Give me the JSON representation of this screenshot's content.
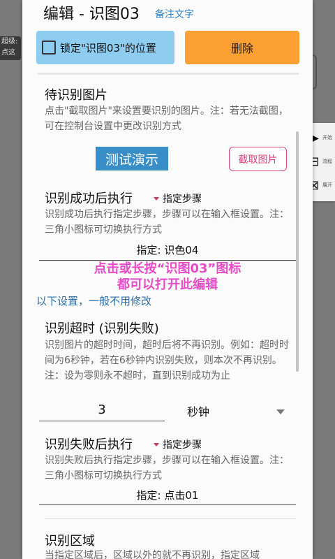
{
  "background": {
    "chip_line1": "超级:",
    "chip_line2": "点这可"
  },
  "float_toolbar": {
    "items": [
      {
        "icon": "play-icon",
        "glyph": "▶",
        "label": "开始"
      },
      {
        "icon": "flow-icon",
        "glyph": "⊟",
        "label": "流程"
      },
      {
        "icon": "collapse-icon",
        "glyph": "⊠",
        "label": "展开"
      }
    ]
  },
  "dialog": {
    "title": "编辑 - 识图03",
    "memo_link": "备注文字",
    "lock_label": "锁定\"识图03\"的位置",
    "delete_label": "删除",
    "image_section": {
      "title": "待识别图片",
      "desc": "点击\"截取图片\"来设置要识别的图片。注：若无法截图，可在控制台设置中更改识别方式",
      "demo_label": "测试演示",
      "capture_label": "截取图片"
    },
    "success_section": {
      "title": "识别成功后执行",
      "mode_label": "指定步骤",
      "desc": "识别成功后执行指定步骤，步骤可以在输入框设置。注：三角小图标可切换执行方式",
      "value": "指定: 识色04"
    },
    "overlay_hint": {
      "line1": "点击或长按“识图03”图标",
      "line2": "都可以打开此编辑"
    },
    "optional_note": "以下设置，一般不用修改",
    "timeout_section": {
      "title": "识别超时 (识别失败)",
      "desc": "识别图片的超时时间，超时后将不再识别。例如：超时时间为6秒钟，若在6秒钟内识别失败，则本次不再识别。注：设为零则永不超时，直到识别成功为止",
      "value": "3",
      "unit": "秒钟"
    },
    "fail_section": {
      "title": "识别失败后执行",
      "mode_label": "指定步骤",
      "desc": "识别失败后执行指定步骤，步骤可以在输入框设置。注：三角小图标可切换执行方式",
      "value": "指定: 点击01"
    },
    "region_section": {
      "title": "识别区域",
      "desc": "当指定区域后，区域以外的就不再识别，指定区域"
    }
  },
  "colors": {
    "lock_button": "#8ecdf0",
    "delete_button": "#fba033",
    "demo_button": "#3a8ec8",
    "capture_border": "#d8457a",
    "overlay_hint": "#e84ac8",
    "link_blue": "#2f82c4"
  }
}
